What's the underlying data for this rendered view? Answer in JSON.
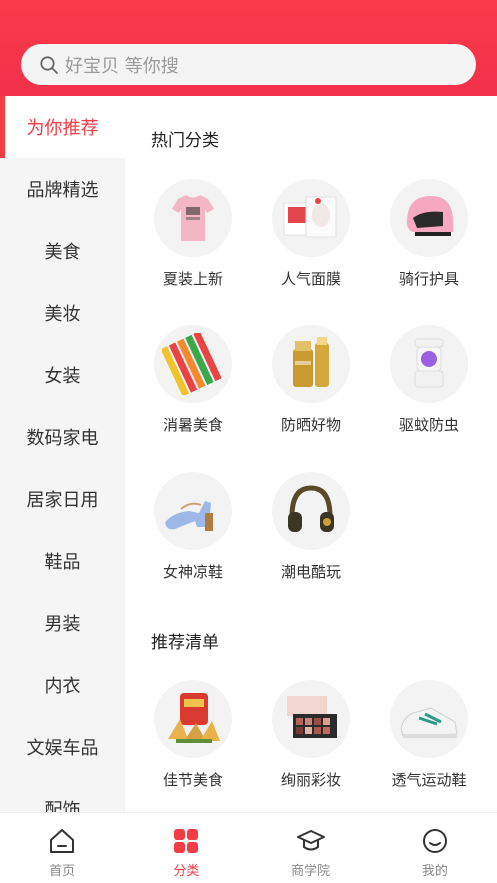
{
  "search": {
    "placeholder": "好宝贝 等你搜",
    "icon": "search-icon"
  },
  "sidebar": {
    "items": [
      {
        "label": "为你推荐",
        "active": true
      },
      {
        "label": "品牌精选"
      },
      {
        "label": "美食"
      },
      {
        "label": "美妆"
      },
      {
        "label": "女装"
      },
      {
        "label": "数码家电"
      },
      {
        "label": "居家日用"
      },
      {
        "label": "鞋品"
      },
      {
        "label": "男装"
      },
      {
        "label": "内衣"
      },
      {
        "label": "文娱车品"
      },
      {
        "label": "配饰"
      }
    ]
  },
  "hot": {
    "title": "热门分类",
    "items": [
      {
        "label": "夏装上新",
        "icon": "tshirt-image"
      },
      {
        "label": "人气面膜",
        "icon": "facemask-image"
      },
      {
        "label": "骑行护具",
        "icon": "helmet-image"
      },
      {
        "label": "消暑美食",
        "icon": "icepop-image"
      },
      {
        "label": "防晒好物",
        "icon": "sunscreen-image"
      },
      {
        "label": "驱蚊防虫",
        "icon": "mosquito-lamp-image"
      },
      {
        "label": "女神凉鞋",
        "icon": "sandals-image"
      },
      {
        "label": "潮电酷玩",
        "icon": "headphones-image"
      }
    ]
  },
  "recommend": {
    "title": "推荐清单",
    "items": [
      {
        "label": "佳节美食",
        "icon": "zongzi-image"
      },
      {
        "label": "绚丽彩妆",
        "icon": "eyeshadow-image"
      },
      {
        "label": "透气运动鞋",
        "icon": "sneaker-image"
      }
    ]
  },
  "tabbar": {
    "items": [
      {
        "label": "首页",
        "icon": "home-icon"
      },
      {
        "label": "分类",
        "icon": "category-icon",
        "active": true
      },
      {
        "label": "商学院",
        "icon": "graduation-cap-icon"
      },
      {
        "label": "我的",
        "icon": "profile-icon"
      }
    ]
  },
  "colors": {
    "accent": "#f43c45",
    "header": "#f83a4a",
    "sidebar_bg": "#f5f5f5"
  }
}
